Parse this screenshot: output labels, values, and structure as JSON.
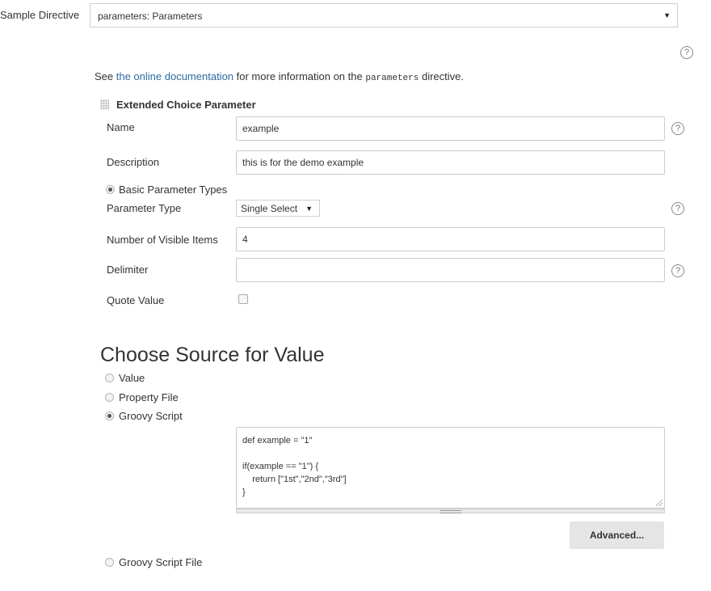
{
  "header": {
    "label": "Sample Directive",
    "select_value": "parameters: Parameters"
  },
  "doc": {
    "prefix": "See ",
    "link": "the online documentation",
    "middle": " for more information on the ",
    "code": "parameters",
    "suffix": " directive."
  },
  "section": {
    "title": "Extended Choice Parameter"
  },
  "fields": {
    "name_label": "Name",
    "name_value": "example",
    "description_label": "Description",
    "description_value": "this is for the demo example",
    "basic_types_label": "Basic Parameter Types",
    "param_type_label": "Parameter Type",
    "param_type_value": "Single Select",
    "visible_items_label": "Number of Visible Items",
    "visible_items_value": "4",
    "delimiter_label": "Delimiter",
    "delimiter_value": "",
    "quote_label": "Quote Value"
  },
  "source": {
    "heading": "Choose Source for Value",
    "options": [
      "Value",
      "Property File",
      "Groovy Script",
      "Groovy Script File"
    ],
    "selected": "Groovy Script",
    "script_lines": [
      "def example = \"1\"",
      "",
      "if(example == \"1\") {",
      "    return [\"1st\",\"2nd\",\"3rd\"]",
      "}"
    ],
    "advanced_button": "Advanced..."
  },
  "icons": {
    "help": "?",
    "caret": "▼"
  },
  "colors": {
    "link": "#2d6aa3",
    "button_bg": "#e5e5e5"
  }
}
